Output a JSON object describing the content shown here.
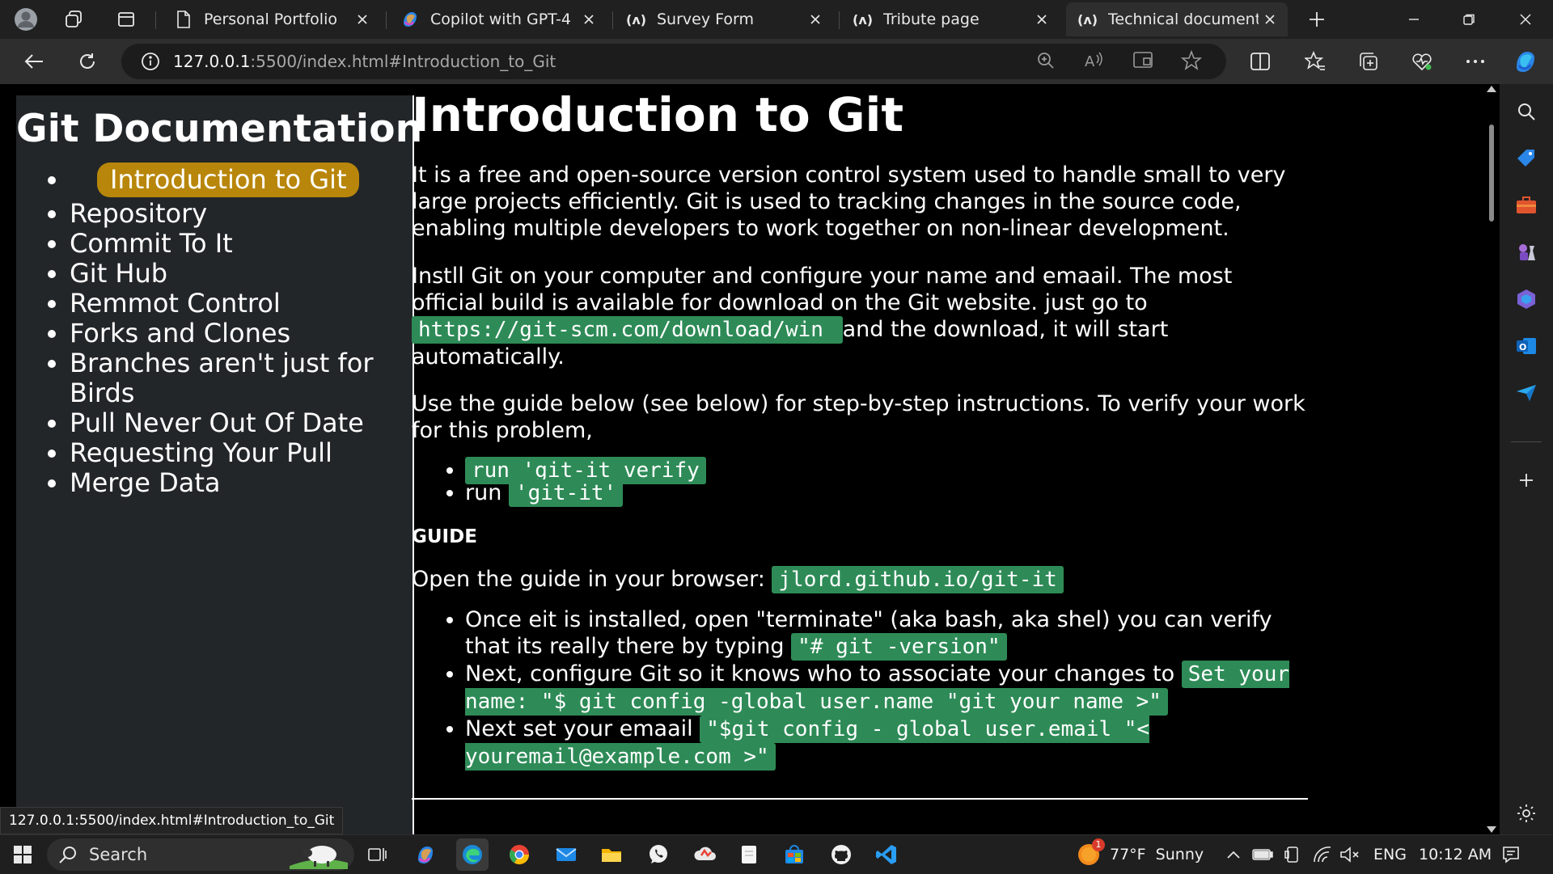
{
  "browser": {
    "tabs": [
      {
        "label": "Personal Portfolio",
        "icon": "page-icon",
        "active": false
      },
      {
        "label": "Copilot with GPT-4",
        "icon": "copilot-icon",
        "active": false
      },
      {
        "label": "Survey Form",
        "icon": "angular-icon",
        "active": false
      },
      {
        "label": "Tribute page",
        "icon": "angular-icon",
        "active": false
      },
      {
        "label": "Technical documentati",
        "icon": "angular-icon",
        "active": true
      }
    ],
    "url": {
      "host": "127.0.0.1",
      "path": ":5500/index.html#Introduction_to_Git"
    },
    "status_url": "127.0.0.1:5500/index.html#Introduction_to_Git",
    "accent_color": "#b8860b",
    "code_color": "#2e8b57"
  },
  "page": {
    "nav_title": "Git Documentation",
    "nav_items": [
      "Introduction to Git",
      "Repository",
      "Commit To It",
      "Git Hub",
      "Remmot Control",
      "Forks and Clones",
      "Branches aren't just for Birds",
      "Pull Never Out Of Date",
      "Requesting Your Pull",
      "Merge Data"
    ],
    "section_title": "Introduction to Git",
    "para1": "It is a free and open-source version control system used to handle small to very large projects efficiently. Git is used to tracking changes in the source code, enabling multiple developers to work together on non-linear development.",
    "para2_before": "Instll Git on your computer and configure your name and emaail. The most official build is available for download on the Git website. just go to ",
    "para2_code": "https://git-scm.com/download/win ",
    "para2_after": " and the download, it will start automatically.",
    "para3": "Use the guide below (see below) for step-by-step instructions. To verify your work for this problem,",
    "list1": [
      {
        "text": "",
        "code": "run 'git-it verify"
      },
      {
        "text": "run ",
        "code": "'git-it'"
      }
    ],
    "guide_heading": "GUIDE",
    "guide_text": "Open the guide in your browser: ",
    "guide_code": "jlord.github.io/git-it",
    "list2": [
      {
        "text": "Once eit is installed, open \"terminate\" (aka bash, aka shel) you can verify that its really there by typing ",
        "code": "\"# git -version\""
      },
      {
        "text": "Next, configure Git so it knows who to associate your changes to ",
        "code": "Set your name: \"$ git config -global user.name \"git your name >\""
      },
      {
        "text": "Next set your emaail ",
        "code": "\"$git config - global user.email \"< youremail@example.com >\""
      }
    ]
  },
  "taskbar": {
    "search_label": "Search",
    "weather": "77°F  Sunny",
    "weather_badge": "1",
    "language": "ENG",
    "time": "10:12 AM"
  }
}
